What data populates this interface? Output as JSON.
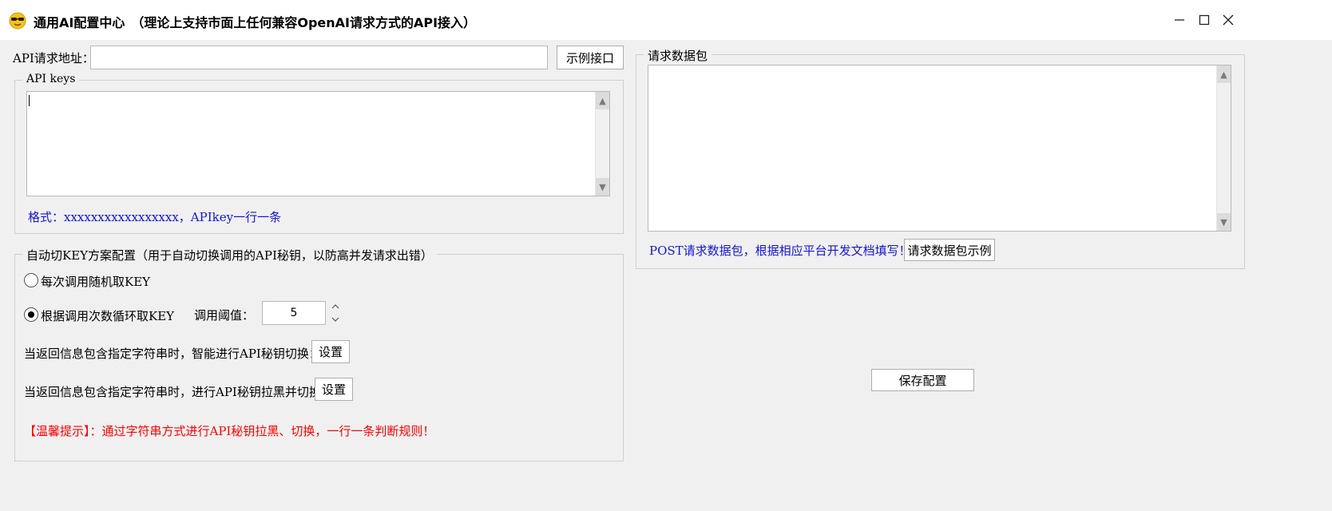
{
  "window": {
    "title": "通用AI配置中心　（理论上支持市面上任何兼容OpenAI请求方式的API接入）",
    "icon": "sunglasses-face-icon",
    "controls": [
      "minimize-icon",
      "maximize-icon",
      "close-icon"
    ]
  },
  "api_url": {
    "label": "API请求地址：",
    "value": "",
    "example_button": "示例接口"
  },
  "api_keys": {
    "legend": "API keys",
    "value": "",
    "hint": "格式：xxxxxxxxxxxxxxxxx，APIkey一行一条"
  },
  "switch_config": {
    "legend": "自动切KEY方案配置（用于自动切换调用的API秘钥，以防高并发请求出错）",
    "options": [
      {
        "label": "每次调用随机取KEY",
        "selected": false
      },
      {
        "label": "根据调用次数循环取KEY",
        "selected": true
      }
    ],
    "threshold_label": "调用阈值：",
    "threshold_value": "5",
    "smart_switch_label": "当返回信息包含指定字符串时，智能进行API秘钥切换：",
    "smart_switch_button": "设置",
    "blacklist_label": "当返回信息包含指定字符串时，进行API秘钥拉黑并切换：",
    "blacklist_button": "设置",
    "tip": "【温馨提示】：通过字符串方式进行API秘钥拉黑、切换，一行一条判断规则！"
  },
  "request_packet": {
    "legend": "请求数据包",
    "value": "",
    "hint": "POST请求数据包，根据相应平台开发文档填写！",
    "example_button": "请求数据包示例"
  },
  "save_button": "保存配置",
  "colors": {
    "hint_blue": "#1515d8",
    "tip_red": "#ff0000",
    "window_bg": "#f0f0f0"
  }
}
